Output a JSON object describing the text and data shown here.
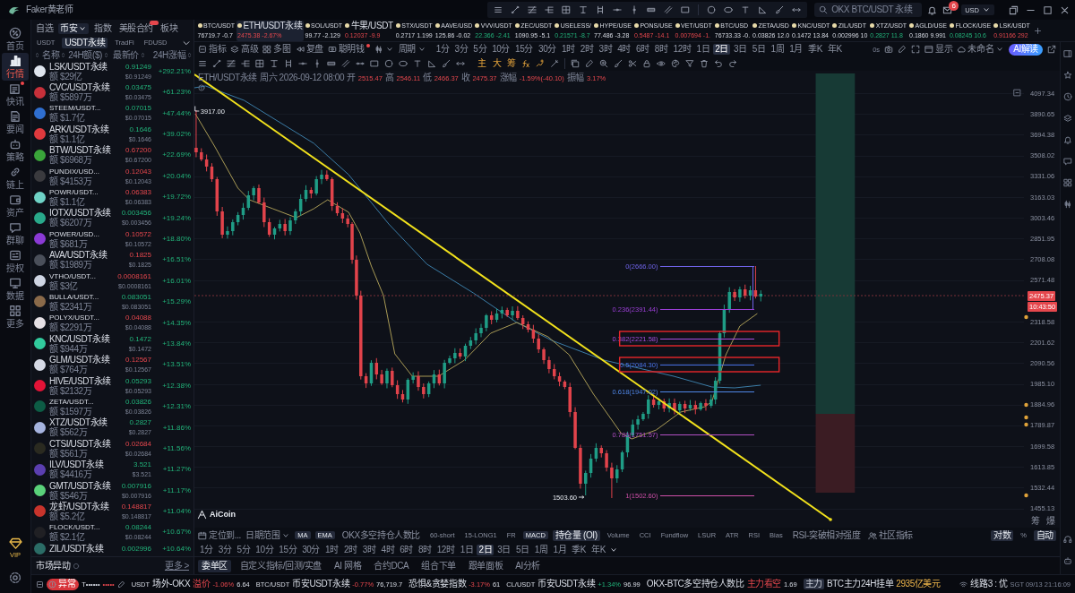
{
  "window": {
    "title": "Faker黄老师",
    "search_placeholder": "OKX BTC/USDT 永续",
    "mail_badge": "6",
    "currency": "USD"
  },
  "nav": [
    {
      "label": "首页",
      "selected": false,
      "alert": false
    },
    {
      "label": "行情",
      "selected": true,
      "alert": false
    },
    {
      "label": "快讯",
      "selected": false,
      "alert": true
    },
    {
      "label": "要闻",
      "selected": false,
      "alert": false
    },
    {
      "label": "策略",
      "selected": false,
      "alert": false
    },
    {
      "label": "链上",
      "selected": false,
      "alert": false
    },
    {
      "label": "资产",
      "selected": false,
      "alert": false
    },
    {
      "label": "群聊",
      "selected": false,
      "alert": false
    },
    {
      "label": "授权",
      "selected": false,
      "alert": false
    },
    {
      "label": "数据",
      "selected": false,
      "alert": false
    },
    {
      "label": "更多",
      "selected": false,
      "alert": false
    }
  ],
  "vip": "VIP",
  "market": {
    "tabs": [
      {
        "label": "自选",
        "selected": false,
        "caret": false,
        "badge": false
      },
      {
        "label": "币安",
        "selected": true,
        "caret": true,
        "badge": false
      },
      {
        "label": "指数",
        "selected": false,
        "caret": false,
        "badge": false
      },
      {
        "label": "美股合约",
        "selected": false,
        "caret": false,
        "badge": true
      },
      {
        "label": "板块",
        "selected": false,
        "caret": false,
        "badge": false
      }
    ],
    "subtabs": [
      {
        "label": "USDT",
        "selected": false
      },
      {
        "label": "USDT永续",
        "selected": true
      },
      {
        "label": "TradFi",
        "selected": false
      },
      {
        "label": "FDUSD",
        "selected": false
      }
    ],
    "columns": [
      "名称",
      "24H额($)",
      "最新价",
      "24H涨幅"
    ],
    "rows": [
      {
        "name": "LSK/USDT永续",
        "volume": "额 $29亿",
        "price": "0.91249",
        "price_up": true,
        "usd": "$0.91249",
        "change": "+292.21%",
        "change_up": true,
        "color": "#dfe5ee"
      },
      {
        "name": "CVC/USDT永续",
        "volume": "额 $5897万",
        "price": "0.03475",
        "price_up": true,
        "usd": "$0.03475",
        "change": "+61.23%",
        "change_up": true,
        "color": "#c7303a"
      },
      {
        "name": "STEEM/USDT...",
        "volume": "额 $1.7亿",
        "price": "0.07015",
        "price_up": true,
        "usd": "$0.07015",
        "change": "+47.44%",
        "change_up": true,
        "color": "#2f6fd1"
      },
      {
        "name": "ARK/USDT永续",
        "volume": "额 $1.1亿",
        "price": "0.1646",
        "price_up": true,
        "usd": "$0.1646",
        "change": "+39.02%",
        "change_up": true,
        "color": "#e03a3e"
      },
      {
        "name": "BTW/USDT永续",
        "volume": "额 $6968万",
        "price": "0.67200",
        "price_up": false,
        "usd": "$0.67200",
        "change": "+22.69%",
        "change_up": true,
        "color": "#3aa53a"
      },
      {
        "name": "PUNDIX/USD...",
        "volume": "额 $4153万",
        "price": "0.12043",
        "price_up": false,
        "usd": "$0.12043",
        "change": "+20.04%",
        "change_up": true,
        "color": "#3a3a3e"
      },
      {
        "name": "POWR/USDT...",
        "volume": "额 $1.1亿",
        "price": "0.06383",
        "price_up": false,
        "usd": "$0.06383",
        "change": "+19.72%",
        "change_up": true,
        "color": "#6fd3c7"
      },
      {
        "name": "IOTX/USDT永续",
        "volume": "额 $6207万",
        "price": "0.003456",
        "price_up": true,
        "usd": "$0.003456",
        "change": "+19.24%",
        "change_up": true,
        "color": "#29a98b"
      },
      {
        "name": "POWER/USD...",
        "volume": "额 $681万",
        "price": "0.10572",
        "price_up": false,
        "usd": "$0.10572",
        "change": "+18.80%",
        "change_up": true,
        "color": "#8b3ad6"
      },
      {
        "name": "AVA/USDT永续",
        "volume": "额 $1989万",
        "price": "0.1825",
        "price_up": false,
        "usd": "$0.1825",
        "change": "+16.51%",
        "change_up": true,
        "color": "#4a4f5a"
      },
      {
        "name": "VTHO/USDT...",
        "volume": "额 $3亿",
        "price": "0.0008161",
        "price_up": false,
        "usd": "$0.0008161",
        "change": "+16.01%",
        "change_up": true,
        "color": "#cfd6e4"
      },
      {
        "name": "BULLA/USDT...",
        "volume": "额 $2341万",
        "price": "0.083051",
        "price_up": true,
        "usd": "$0.083051",
        "change": "+15.29%",
        "change_up": true,
        "color": "#8a6a4a"
      },
      {
        "name": "POLYX/USDT...",
        "volume": "额 $2291万",
        "price": "0.04088",
        "price_up": false,
        "usd": "$0.04088",
        "change": "+14.35%",
        "change_up": true,
        "color": "#e6e1e6"
      },
      {
        "name": "KNC/USDT永续",
        "volume": "额 $944万",
        "price": "0.1472",
        "price_up": true,
        "usd": "$0.1472",
        "change": "+13.84%",
        "change_up": true,
        "color": "#31cb9e"
      },
      {
        "name": "GLM/USDT永续",
        "volume": "额 $764万",
        "price": "0.12567",
        "price_up": false,
        "usd": "$0.12567",
        "change": "+13.51%",
        "change_up": true,
        "color": "#d6dae6"
      },
      {
        "name": "HIVE/USDT永续",
        "volume": "额 $2132万",
        "price": "0.05293",
        "price_up": true,
        "usd": "$0.05293",
        "change": "+12.38%",
        "change_up": true,
        "color": "#e31337"
      },
      {
        "name": "ZETA/USDT...",
        "volume": "额 $1597万",
        "price": "0.03826",
        "price_up": true,
        "usd": "$0.03826",
        "change": "+12.31%",
        "change_up": true,
        "color": "#0d5c45"
      },
      {
        "name": "XTZ/USDT永续",
        "volume": "额 $562万",
        "price": "0.2827",
        "price_up": true,
        "usd": "$0.2827",
        "change": "+11.86%",
        "change_up": true,
        "color": "#a6b4e0"
      },
      {
        "name": "CTSI/USDT永续",
        "volume": "额 $561万",
        "price": "0.02684",
        "price_up": false,
        "usd": "$0.02684",
        "change": "+11.56%",
        "change_up": true,
        "color": "#2a2a20"
      },
      {
        "name": "ILV/USDT永续",
        "volume": "额 $4416万",
        "price": "3.521",
        "price_up": true,
        "usd": "$3.521",
        "change": "+11.27%",
        "change_up": true,
        "color": "#5b3fb0"
      },
      {
        "name": "GMT/USDT永续",
        "volume": "额 $546万",
        "price": "0.007916",
        "price_up": true,
        "usd": "$0.007916",
        "change": "+11.17%",
        "change_up": true,
        "color": "#5ad27a"
      },
      {
        "name": "龙虾/USDT永续",
        "volume": "额 $5.2亿",
        "price": "0.148817",
        "price_up": false,
        "usd": "$0.148817",
        "change": "+11.04%",
        "change_up": true,
        "color": "#c8342c"
      },
      {
        "name": "FLOCK/USDT...",
        "volume": "额 $2.1亿",
        "price": "0.08244",
        "price_up": true,
        "usd": "$0.08244",
        "change": "+10.67%",
        "change_up": true,
        "color": "#202024"
      },
      {
        "name": "ZIL/USDT永续",
        "price": "0.002996",
        "price_up": true,
        "change": "+10.64%",
        "change_up": true,
        "color": "#2b6c66"
      }
    ],
    "footer": {
      "title": "市场异动",
      "more": "更多 >"
    }
  },
  "ticker": [
    {
      "name": "BTC/USDT",
      "price": "76719.7",
      "change": "-0.7",
      "up": false,
      "down": false,
      "selected": false
    },
    {
      "name": "ETH/USDT永续",
      "price": "2475.38",
      "change": "-2.67%",
      "up": false,
      "down": true,
      "selected": true
    },
    {
      "name": "SOL/USDT",
      "price": "99.77",
      "change": "-2.129",
      "up": false,
      "down": false,
      "selected": false
    },
    {
      "name": "牛果/USDT",
      "price": "0.12037",
      "change": "-9.9",
      "up": false,
      "down": true,
      "selected": false
    },
    {
      "name": "STX/USDT",
      "price": "0.2717",
      "change": "1.199",
      "up": false,
      "down": false,
      "selected": false
    },
    {
      "name": "AAVE/USD",
      "price": "125.86",
      "change": "-0.02",
      "up": false,
      "down": false,
      "selected": false
    },
    {
      "name": "VVV/USDT",
      "price": "22.366",
      "change": "-2.41",
      "up": true,
      "down": false,
      "selected": false
    },
    {
      "name": "ZEC/USDT",
      "price": "1090.95",
      "change": "-5.1",
      "up": false,
      "down": false,
      "selected": false
    },
    {
      "name": "USELESS/",
      "price": "0.21571",
      "change": "-8.7",
      "up": true,
      "down": false,
      "selected": false
    },
    {
      "name": "HYPE/USE",
      "price": "77.486",
      "change": "-3.28",
      "up": false,
      "down": false,
      "selected": false
    },
    {
      "name": "PONS/USE",
      "price": "0.5487",
      "change": "-14.1",
      "up": false,
      "down": true,
      "selected": false
    },
    {
      "name": "VET/USDT",
      "price": "0.007694",
      "change": "-1.",
      "up": false,
      "down": true,
      "selected": false
    },
    {
      "name": "BTC/USD",
      "price": "76733.33",
      "change": "-0.",
      "up": false,
      "down": false,
      "selected": false
    },
    {
      "name": "ZETA/USD",
      "price": "0.03826",
      "change": "12.0",
      "up": false,
      "down": false,
      "selected": false
    },
    {
      "name": "KNC/USDT",
      "price": "0.1472",
      "change": "13.84",
      "up": false,
      "down": false,
      "selected": false
    },
    {
      "name": "ZIL/USDT",
      "price": "0.002996",
      "change": "10",
      "up": false,
      "down": false,
      "selected": false
    },
    {
      "name": "XTZ/USDT",
      "price": "0.2827",
      "change": "11.8",
      "up": true,
      "down": false,
      "selected": false
    },
    {
      "name": "AGLD/USE",
      "price": "0.1860",
      "change": "9.991",
      "up": false,
      "down": false,
      "selected": false
    },
    {
      "name": "FLOCK/USE",
      "price": "0.08245",
      "change": "10.6",
      "up": true,
      "down": false,
      "selected": false
    },
    {
      "name": "LSK/USDT",
      "price": "0.91166",
      "change": "292",
      "up": false,
      "down": true,
      "selected": false
    }
  ],
  "toolbar": {
    "tools": [
      {
        "label": "指标",
        "alert": false
      },
      {
        "label": "高级",
        "alert": false
      },
      {
        "label": "多图",
        "alert": false
      },
      {
        "label": "复盘",
        "alert": false
      },
      {
        "label": "聪明钱",
        "alert": true
      }
    ],
    "period_menu": "周期",
    "periods": [
      {
        "label": "1分",
        "selected": false
      },
      {
        "label": "3分",
        "selected": false
      },
      {
        "label": "5分",
        "selected": false
      },
      {
        "label": "10分",
        "selected": false
      },
      {
        "label": "15分",
        "selected": false
      },
      {
        "label": "30分",
        "selected": false
      },
      {
        "label": "1时",
        "selected": false
      },
      {
        "label": "2时",
        "selected": false
      },
      {
        "label": "3时",
        "selected": false
      },
      {
        "label": "4时",
        "selected": false
      },
      {
        "label": "6时",
        "selected": false
      },
      {
        "label": "8时",
        "selected": false
      },
      {
        "label": "12时",
        "selected": false
      },
      {
        "label": "1日",
        "selected": false
      },
      {
        "label": "2日",
        "selected": true
      },
      {
        "label": "3日",
        "selected": false
      },
      {
        "label": "5日",
        "selected": false
      },
      {
        "label": "1周",
        "selected": false
      },
      {
        "label": "1月",
        "selected": false
      },
      {
        "label": "季K",
        "selected": false
      },
      {
        "label": "年K",
        "selected": false
      }
    ],
    "latency": "0s",
    "display": "显示",
    "layout_name": "未命名",
    "ai_button": "AI解读"
  },
  "drawing_bar": {
    "toggles": [
      "主",
      "大",
      "筹"
    ]
  },
  "chart": {
    "info": {
      "symbol": "ETH/USDT永续",
      "time": "周六 2026-09-12 08:00",
      "up": false,
      "fields": [
        {
          "label": "开",
          "value": "2515.47"
        },
        {
          "label": "高",
          "value": "2546.11"
        },
        {
          "label": "低",
          "value": "2466.37"
        },
        {
          "label": "收",
          "value": "2475.37"
        },
        {
          "label": "涨幅",
          "value": "-1.59%(-40.10)"
        },
        {
          "label": "振幅",
          "value": "3.17%"
        }
      ]
    },
    "high_marker": "3917.00",
    "low_marker": "1503.60",
    "fib_levels": [
      {
        "label": "0(2666.00)",
        "color": "#6f63e8",
        "boxed": false
      },
      {
        "label": "0.236(2391.44)",
        "color": "#9b3fd6",
        "boxed": false
      },
      {
        "label": "0.382(2221.58)",
        "color": "#a84ee0",
        "boxed": true
      },
      {
        "label": "0.5(2084.30)",
        "color": "#4a73e8",
        "boxed": true
      },
      {
        "label": "0.618(1947.02)",
        "color": "#4f86e6",
        "boxed": false
      },
      {
        "label": "0.786(1751.57)",
        "color": "#b24fc4",
        "boxed": false
      },
      {
        "label": "1(1502.60)",
        "color": "#cf4fa8",
        "boxed": false
      }
    ],
    "price_axis": [
      "4097.34",
      "3890.65",
      "3694.38",
      "3508.02",
      "3331.06",
      "3163.03",
      "3003.46",
      "2851.95",
      "2708.08",
      "2571.48",
      "2318.58",
      "2201.62",
      "2090.56",
      "1985.10",
      "1884.96",
      "1789.87",
      "1699.58",
      "1613.85",
      "1532.44",
      "1455.13"
    ],
    "last_price": "2475.37",
    "countdown": "10:43:50",
    "watermark": "AiCoin",
    "axis_toggles": [
      "筹",
      "爆"
    ]
  },
  "indicator_bar": {
    "locate": "定位到...",
    "date_range": "日期范围",
    "indicators": [
      {
        "label": "MA",
        "selected": true
      },
      {
        "label": "EMA",
        "selected": true
      },
      {
        "label": "OKX多空持仓人数比",
        "selected": false
      },
      {
        "label": "60-short",
        "selected": false
      },
      {
        "label": "15-LONG1",
        "selected": false
      },
      {
        "label": "FR",
        "selected": false
      },
      {
        "label": "MACD",
        "selected": true
      },
      {
        "label": "持仓量 (OI)",
        "selected": true
      },
      {
        "label": "Volume",
        "selected": false
      },
      {
        "label": "CCI",
        "selected": false
      },
      {
        "label": "Fundflow",
        "selected": false
      },
      {
        "label": "LSUR",
        "selected": false
      },
      {
        "label": "ATR",
        "selected": false
      },
      {
        "label": "RSI",
        "selected": false
      },
      {
        "label": "Bias",
        "selected": false
      },
      {
        "label": "RSI-突破相对强度",
        "selected": false
      }
    ],
    "community": "社区指标",
    "scales": [
      {
        "label": "对数",
        "selected": true
      },
      {
        "label": "%",
        "selected": false
      },
      {
        "label": "自动",
        "selected": true
      }
    ]
  },
  "bottom_periods": [
    {
      "label": "1分",
      "selected": false
    },
    {
      "label": "3分",
      "selected": false
    },
    {
      "label": "5分",
      "selected": false
    },
    {
      "label": "10分",
      "selected": false
    },
    {
      "label": "15分",
      "selected": false
    },
    {
      "label": "30分",
      "selected": false
    },
    {
      "label": "1时",
      "selected": false
    },
    {
      "label": "2时",
      "selected": false
    },
    {
      "label": "3时",
      "selected": false
    },
    {
      "label": "4时",
      "selected": false
    },
    {
      "label": "6时",
      "selected": false
    },
    {
      "label": "8时",
      "selected": false
    },
    {
      "label": "12时",
      "selected": false
    },
    {
      "label": "1日",
      "selected": false
    },
    {
      "label": "2日",
      "selected": true
    },
    {
      "label": "3日",
      "selected": false
    },
    {
      "label": "5日",
      "selected": false
    },
    {
      "label": "1周",
      "selected": false
    },
    {
      "label": "1月",
      "selected": false
    },
    {
      "label": "季K",
      "selected": false
    },
    {
      "label": "年K",
      "selected": false
    }
  ],
  "panel_tabs": [
    {
      "label": "委单区",
      "selected": true
    },
    {
      "label": "自定义指标/回测/实盘",
      "selected": false
    },
    {
      "label": "AI 网格",
      "selected": false
    },
    {
      "label": "合约DCA",
      "selected": false
    },
    {
      "label": "组合下单",
      "selected": false
    },
    {
      "label": "跟单面板",
      "selected": false
    },
    {
      "label": "AI分析",
      "selected": false
    }
  ],
  "status_bar": {
    "alert": "异常",
    "account": "T••••••",
    "masked": "•••••",
    "items": [
      {
        "label": "USDT",
        "market": "场外-OKX",
        "note": "溢价",
        "change": "-1.06%",
        "up": false,
        "value": "6.64"
      },
      {
        "label": "BTC/USDT",
        "market": "币安USDT永续",
        "change": "-0.77%",
        "up": false,
        "value": "76,719.7"
      },
      {
        "label": "恐惧&贪婪指数",
        "change": "-3.17%",
        "up": false,
        "value": "61"
      },
      {
        "label": "CL/USDT",
        "market": "币安USDT永续",
        "change": "+1.34%",
        "up": true,
        "value": "96.99"
      },
      {
        "label": "OKX-BTC多空持仓人数比",
        "note": "主力看空",
        "value": "1.69"
      }
    ],
    "whale": {
      "tag": "主力",
      "label": "BTC主力24H挂单",
      "value": "2935亿美元"
    },
    "line": "线路3 : 优",
    "clock": "SGT 09/13 21:16:09"
  }
}
